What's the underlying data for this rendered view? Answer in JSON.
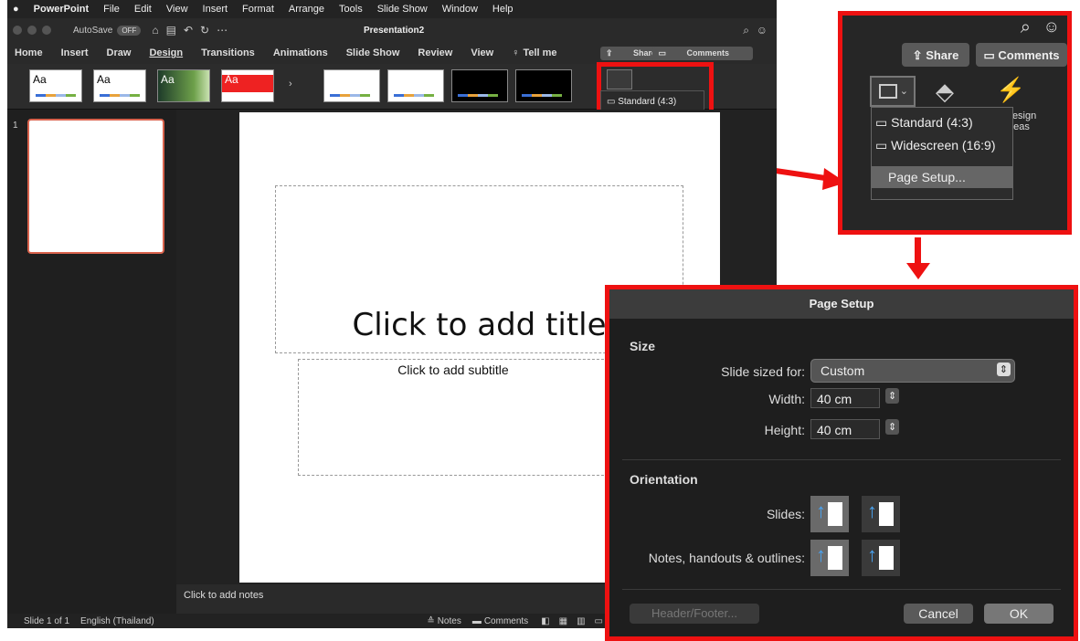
{
  "menubar": {
    "app": "PowerPoint",
    "items": [
      "File",
      "Edit",
      "View",
      "Insert",
      "Format",
      "Arrange",
      "Tools",
      "Slide Show",
      "Window",
      "Help"
    ]
  },
  "titlebar": {
    "autosave": "AutoSave",
    "autosave_state": "OFF",
    "title": "Presentation2"
  },
  "ribbon": {
    "tabs": [
      "Home",
      "Insert",
      "Draw",
      "Design",
      "Transitions",
      "Animations",
      "Slide Show",
      "Review",
      "View",
      "Tell me"
    ],
    "share": "Share",
    "comments": "Comments",
    "theme_label": "Aa"
  },
  "slide_panel": {
    "number": "1"
  },
  "slide": {
    "title_placeholder": "Click to add title",
    "subtitle_placeholder": "Click to add subtitle"
  },
  "notes": {
    "placeholder": "Click to add notes"
  },
  "status": {
    "slide": "Slide 1 of 1",
    "language": "English (Thailand)",
    "notes": "Notes",
    "comments": "Comments"
  },
  "dropdown": {
    "standard": "Standard (4:3)",
    "widescreen": "Widescreen (16:9)",
    "page_setup": "Page Setup...",
    "design_ideas": "Design Ideas"
  },
  "dialog": {
    "title": "Page Setup",
    "size_heading": "Size",
    "slide_sized_for_label": "Slide sized for:",
    "slide_sized_for_value": "Custom",
    "width_label": "Width:",
    "width_value": "40 cm",
    "height_label": "Height:",
    "height_value": "40 cm",
    "orientation_heading": "Orientation",
    "slides_label": "Slides:",
    "notes_label": "Notes, handouts & outlines:",
    "header_footer": "Header/Footer...",
    "cancel": "Cancel",
    "ok": "OK"
  },
  "colors": {
    "highlight": "#ee1111",
    "accent": "#d9634d"
  }
}
